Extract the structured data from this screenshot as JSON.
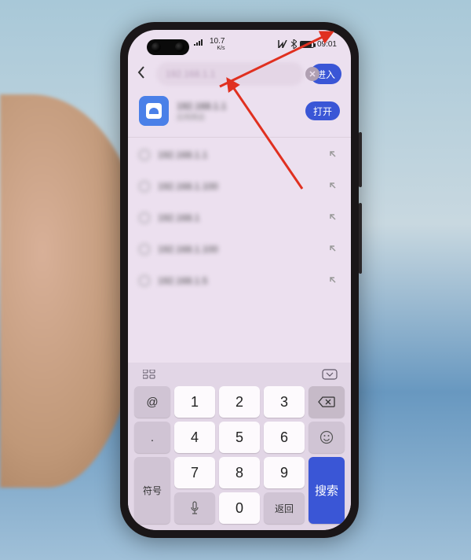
{
  "status_bar": {
    "net_speed": "10.7",
    "net_unit": "K/s",
    "time": "09:01"
  },
  "search": {
    "query": "192.168.1.1",
    "enter_label": "进入"
  },
  "top_result": {
    "title": "192.168.1.1",
    "subtitle": "应用商店",
    "open_label": "打开"
  },
  "suggestions": [
    {
      "text": "192.168.1.1"
    },
    {
      "text": "192.168.1.100"
    },
    {
      "text": "192.168.1"
    },
    {
      "text": "192.168.1.100"
    },
    {
      "text": "192.168.1.5"
    }
  ],
  "keyboard": {
    "at": "@",
    "dot": ".",
    "symbols": "符号",
    "enter": "返回",
    "search": "搜索",
    "digits": [
      "1",
      "2",
      "3",
      "4",
      "5",
      "6",
      "7",
      "8",
      "9",
      "0"
    ]
  }
}
